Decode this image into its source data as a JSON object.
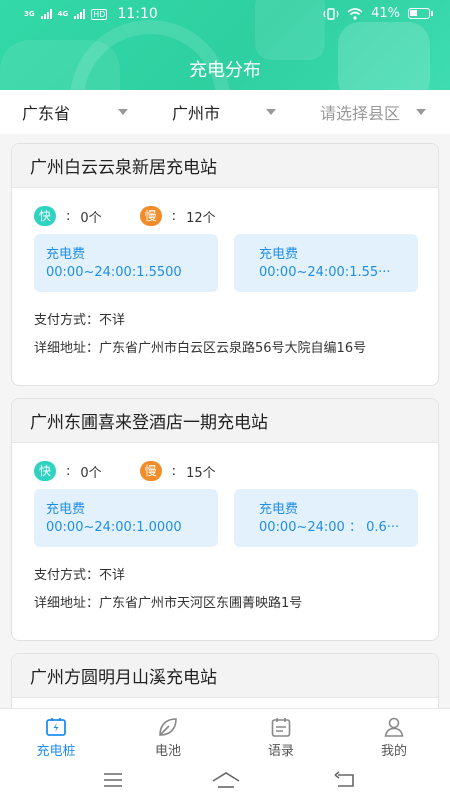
{
  "status_bar": {
    "network_1": "3G",
    "network_2": "4G",
    "hd": "HD",
    "time": "11:10",
    "battery": "41%"
  },
  "header": {
    "title": "充电分布"
  },
  "filters": {
    "province": "广东省",
    "city": "广州市",
    "district_placeholder": "请选择县区"
  },
  "stations": [
    {
      "name": "广州白云云泉新居充电站",
      "fast_label": "快",
      "fast_count": "0个",
      "slow_label": "慢",
      "slow_count": "12个",
      "fees": [
        {
          "title": "充电费",
          "detail": "00:00~24:00:1.5500"
        },
        {
          "title": "充电费",
          "detail": "00:00~24:00:1.55···"
        }
      ],
      "payment_label": "支付方式：",
      "payment_value": "不详",
      "address_label": "详细地址：",
      "address_value": "广东省广州市白云区云泉路56号大院自编16号"
    },
    {
      "name": "广州东圃喜来登酒店一期充电站",
      "fast_label": "快",
      "fast_count": "0个",
      "slow_label": "慢",
      "slow_count": "15个",
      "fees": [
        {
          "title": "充电费",
          "detail": "00:00~24:00:1.0000"
        },
        {
          "title": "充电费",
          "detail": "00:00~24:00 ： 0.6···"
        }
      ],
      "payment_label": "支付方式：",
      "payment_value": "不详",
      "address_label": "详细地址：",
      "address_value": "广东省广州市天河区东圃菁映路1号"
    },
    {
      "name": "广州方圆明月山溪充电站"
    }
  ],
  "bottom_nav": [
    {
      "label": "充电桩",
      "icon": "charging-pile-icon",
      "active": true
    },
    {
      "label": "电池",
      "icon": "leaf-icon",
      "active": false
    },
    {
      "label": "语录",
      "icon": "calendar-icon",
      "active": false
    },
    {
      "label": "我的",
      "icon": "user-icon",
      "active": false
    }
  ],
  "colors": {
    "header": "#33d9a8",
    "fast_badge": "#2fd3c2",
    "slow_badge": "#f08c2a",
    "fee_text": "#1f8ee6",
    "fee_bg": "#e3f1fc",
    "nav_active": "#1e8ef0"
  }
}
